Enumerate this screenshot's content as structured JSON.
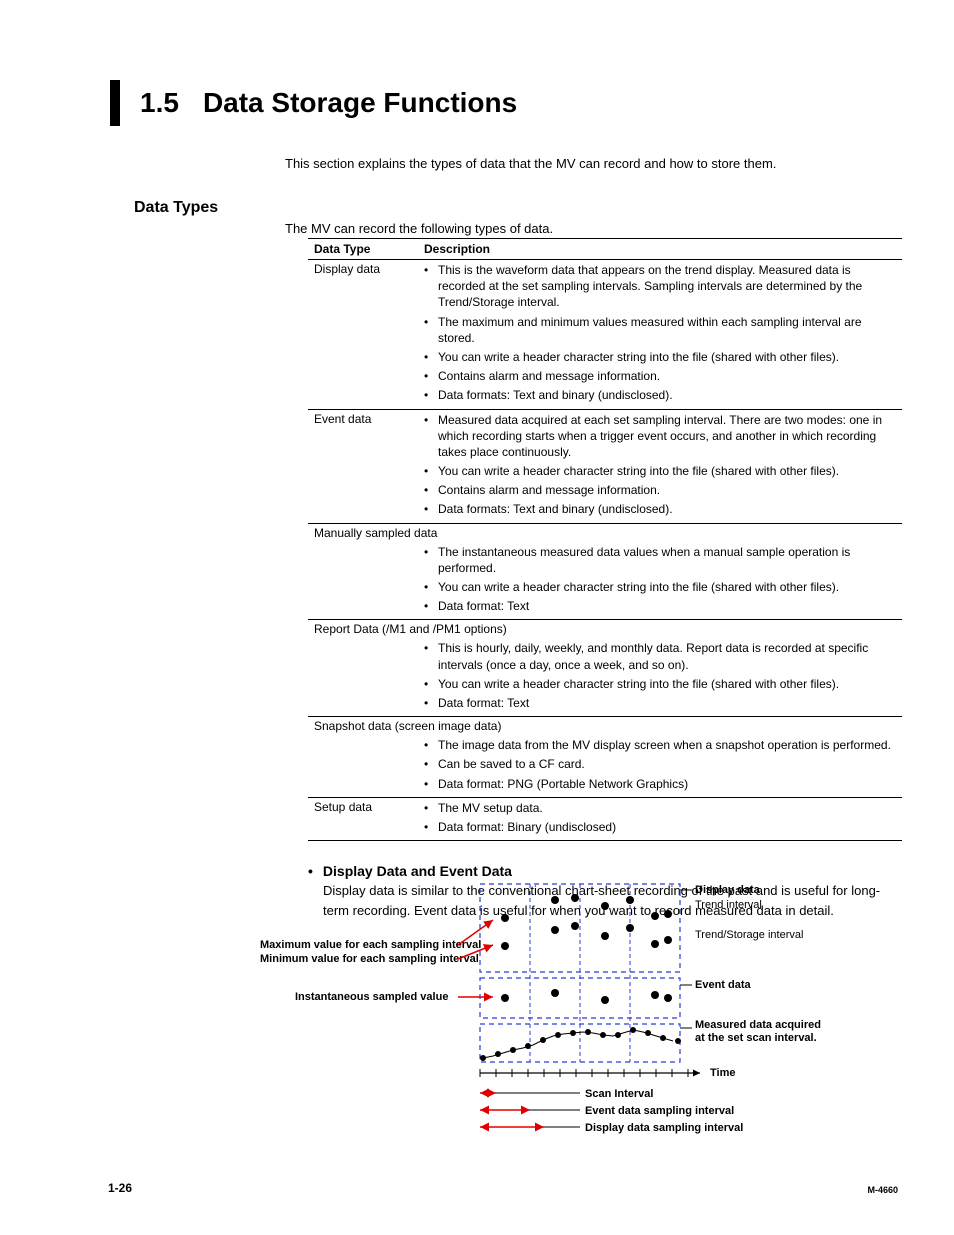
{
  "title": {
    "number": "1.5",
    "text": "Data Storage Functions"
  },
  "intro": "This section explains the types of data that the MV can record and how to store them.",
  "section": {
    "heading": "Data Types",
    "intro": "The MV can record the following types of data."
  },
  "table": {
    "headers": {
      "type": "Data Type",
      "desc": "Description"
    },
    "rows": [
      {
        "type": "Display data",
        "bullets": [
          "This is the waveform data that appears on the trend display. Measured data is recorded at the set sampling intervals. Sampling intervals are determined by the Trend/Storage interval.",
          "The maximum and minimum values measured within each sampling interval are stored.",
          "You can write a header character string into the file (shared with other files).",
          "Contains alarm and message information.",
          "Data formats: Text and binary (undisclosed)."
        ]
      },
      {
        "type": "Event data",
        "bullets": [
          "Measured data acquired at each set sampling interval. There are two modes: one in which recording starts when a trigger event occurs, and another in which recording takes place continuously.",
          "You can write a header character string into the file (shared with other files).",
          "Contains alarm and message information.",
          "Data formats: Text and binary (undisclosed)."
        ]
      },
      {
        "span": "Manually sampled data",
        "bullets": [
          "The instantaneous measured data values when a manual sample operation is performed.",
          "You can write a header character string into the file (shared with other files).",
          "Data format: Text"
        ]
      },
      {
        "span": "Report Data (/M1 and /PM1 options)",
        "bullets": [
          "This is hourly, daily, weekly, and monthly data. Report data is recorded at specific intervals (once a day, once a week, and so on).",
          "You can write a header character string into the file (shared with other files).",
          "Data format: Text"
        ]
      },
      {
        "span": "Snapshot data (screen image data)",
        "bullets": [
          "The image data from the MV display screen when a snapshot operation is performed.",
          "Can be saved to a CF card.",
          "Data format: PNG (Portable Network Graphics)"
        ]
      },
      {
        "type": "Setup data",
        "bullets": [
          "The MV setup data.",
          "Data format: Binary (undisclosed)"
        ]
      }
    ]
  },
  "subsection": {
    "heading": "Display Data and Event Data",
    "paragraph": "Display data is similar to the conventional chart-sheet recording of the past and is useful for long-term recording. Event data is useful for when you want to record measured data in detail."
  },
  "diagram": {
    "labels": {
      "maxval": "Maximum value for each sampling interval",
      "minval": "Minimum value for each sampling interval",
      "instant": "Instantaneous sampled value",
      "display_data": "Display data",
      "trend_interval": "Trend interval",
      "trend_storage": "Trend/Storage interval",
      "event_data": "Event data",
      "measured1": "Measured data acquired",
      "measured2": "at the set scan interval.",
      "time": "Time",
      "scan_interval": "Scan Interval",
      "event_sampling": "Event data sampling interval",
      "display_sampling": "Display data sampling interval"
    }
  },
  "footer": {
    "page": "1-26",
    "doc": "M-4660"
  }
}
